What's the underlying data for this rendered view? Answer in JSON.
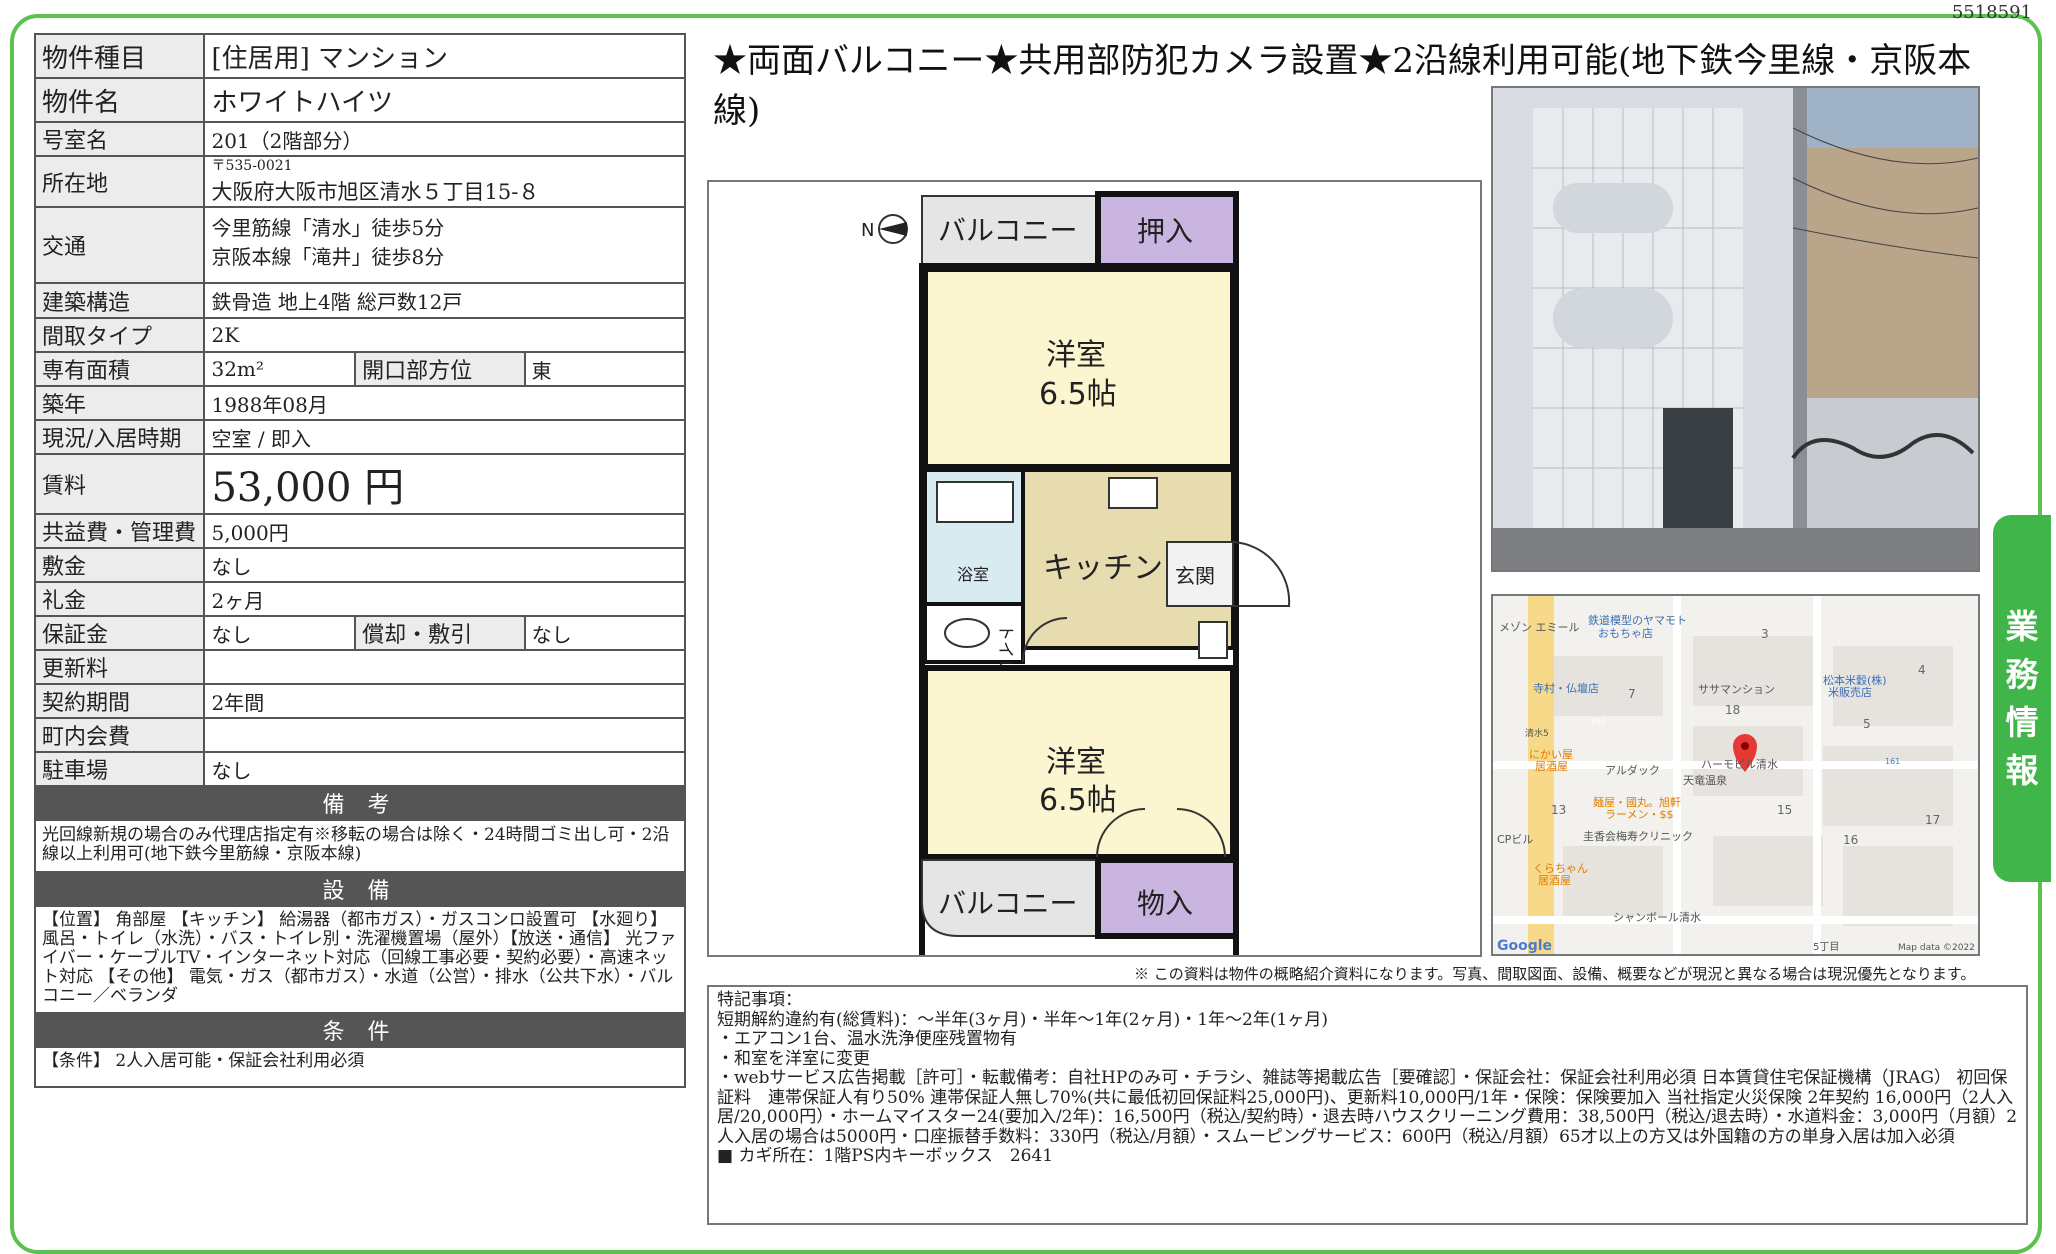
{
  "doc_id": "5518591",
  "side_tab": [
    "業",
    "務",
    "情",
    "報"
  ],
  "table": {
    "type_label": "物件種目",
    "type_value": "[住居用]  マンション",
    "name_label": "物件名",
    "name_value": "ホワイトハイツ",
    "room_label": "号室名",
    "room_value": "201（2階部分）",
    "address_label": "所在地",
    "address_zip": "〒535-0021",
    "address_value": "大阪府大阪市旭区清水５丁目15-８",
    "access_label": "交通",
    "access_line1": "今里筋線「清水」徒歩5分",
    "access_line2": "京阪本線「滝井」徒歩8分",
    "structure_label": "建築構造",
    "structure_value": "鉄骨造  地上4階  総戸数12戸",
    "layout_label": "間取タイプ",
    "layout_value": "2K",
    "area_label": "専有面積",
    "area_value": "32m²",
    "direction_label": "開口部方位",
    "direction_value": "東",
    "built_label": "築年",
    "built_value": "1988年08月",
    "status_label": "現況/入居時期",
    "status_value": "空室  /  即入",
    "rent_label": "賃料",
    "rent_value": "53,000 円",
    "fee_label": "共益費・管理費",
    "fee_value": "5,000円",
    "deposit_label": "敷金",
    "deposit_value": "なし",
    "key_label": "礼金",
    "key_value": "2ヶ月",
    "guarantee_label": "保証金",
    "guarantee_value": "なし",
    "repay_label": "償却・敷引",
    "repay_value": "なし",
    "renew_label": "更新料",
    "renew_value": "",
    "contract_label": "契約期間",
    "contract_value": "2年間",
    "town_label": "町内会費",
    "town_value": "",
    "parking_label": "駐車場",
    "parking_value": "なし"
  },
  "notes_header": "備 考",
  "notes_text": "光回線新規の場合のみ代理店指定有※移転の場合は除く・24時間ゴミ出し可・2沿線以上利用可(地下鉄今里筋線・京阪本線)",
  "equip_header": "設 備",
  "equip_text": "【位置】 角部屋 【キッチン】 給湯器（都市ガス）・ガスコンロ設置可 【水廻り】 風呂・トイレ（水洗）・バス・トイレ別・洗濯機置場（屋外）【放送・通信】 光ファイバー・ケーブルTV・インターネット対応（回線工事必要・契約必要）・高速ネット対応 【その他】 電気・ガス（都市ガス）・水道（公営）・排水（公共下水）・バルコニー／ベランダ",
  "cond_header": "条 件",
  "cond_text": "【条件】 2人入居可能・保証会社利用必須",
  "headline": "★両面バルコニー★共用部防犯カメラ設置★2沿線利用可能(地下鉄今里線・京阪本線)",
  "floorplan": {
    "balcony_top": "バルコニー",
    "oshiire": "押入",
    "room1_name": "洋室",
    "room1_size": "6.5帖",
    "bath": "浴室",
    "kitchen": "キッチン",
    "genkan": "玄関",
    "toilet": "トイレ",
    "room2_name": "洋室",
    "room2_size": "6.5帖",
    "balcony_bottom": "バルコニー",
    "monoire": "物入",
    "north": "N"
  },
  "map": {
    "labels": [
      "メゾン エミール",
      "鉄道模型のヤマモト",
      "おもちゃ店",
      "寺村・仏壇店",
      "ササマンション",
      "松本米穀(株)",
      "米販売店",
      "清水5",
      "にかい屋",
      "居酒屋",
      "アルダック",
      "天竜温泉",
      "ハーモピル清水",
      "麺屋・國丸。旭軒",
      "ラーメン・$$",
      "圭香会梅寿クリニック",
      "CPビル",
      "くらちゃん",
      "居酒屋",
      "シャンボール清水",
      "Google",
      "Map data ©2022",
      "5丁目"
    ],
    "numbers": [
      "3",
      "4",
      "18",
      "5",
      "7",
      "161",
      "161",
      "15",
      "13",
      "17",
      "16"
    ]
  },
  "disclaimer": "※ この資料は物件の概略紹介資料になります。写真、間取図面、設備、概要などが現況と異なる場合は現況優先となります。",
  "remarks": [
    "特記事項：",
    "短期解約違約有(総賃料)：～半年(3ヶ月)・半年～1年(2ヶ月)・1年～2年(1ヶ月)",
    "・エアコン1台、温水洗浄便座残置物有",
    "・和室を洋室に変更",
    "・webサービス広告掲載［許可］・転載備考：自社HPのみ可・チラシ、雑誌等掲載広告［要確認］・保証会社：保証会社利用必須 日本賃貸住宅保証機構（JRAG） 初回保証料　連帯保証人有り50% 連帯保証人無し70%(共に最低初回保証料25,000円)、更新料10,000円/1年・保険：保険要加入 当社指定火災保険 2年契約 16,000円（2人入居/20,000円）・ホームマイスター24(要加入/2年)：16,500円（税込/契約時）・退去時ハウスクリーニング費用：38,500円（税込/退去時）・水道料金：3,000円（月額）2人入居の場合は5000円・口座振替手数料：330円（税込/月額）・スムーピングサービス：600円（税込/月額）65才以上の方又は外国籍の方の単身入居は加入必須",
    "■ カギ所在：1階PS内キーボックス　2641"
  ],
  "colors": {
    "accent_green": "#5cc24f",
    "tab_green": "#3fb54a",
    "header_gray": "#555555",
    "room_yellow": "#fbf6cf",
    "kitchen_tan": "#e6dcb0",
    "storage_purple": "#c9b5df",
    "bath_blue": "#d8ebf0"
  }
}
